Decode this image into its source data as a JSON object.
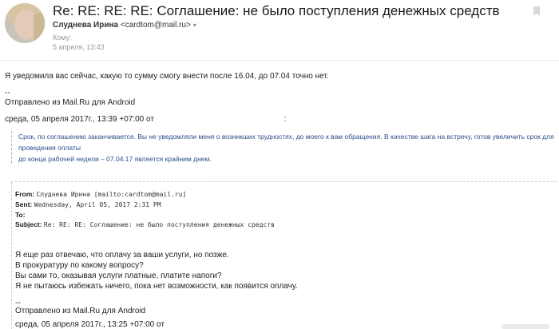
{
  "header": {
    "subject": "Re: RE: RE: RE: Соглашение: не было поступления денежных средств",
    "from_name": "Слуднева Ирина",
    "from_email": "<cardtom@mail.ru>",
    "to_label": "Кому:",
    "date": "5 апреля, 13:43"
  },
  "body": {
    "line1": "Я уведомила вас сейчас, какую то сумму смогу внести после 16.04, до 07.04 точно нет.",
    "dash1": "--",
    "sent_from1": "Отправлено из Mail.Ru для Android",
    "quote_header1": "среда, 05 апреля 2017г., 13:39 +07:00 от",
    "quote_header1_tail": ":",
    "quote_line1": "Срок, по соглашению заканчивается. Вы не уведомляли меня о возникших трудностях, до моего к вам обращения. В качестве шага на встречу, готов увеличить срок для проведения оплаты",
    "quote_line2": "до конца рабочей недели – 07.04.17 является крайним днем."
  },
  "inner": {
    "from_label": "From:",
    "from_value": "Слуднева Ирина [mailto:cardtom@mail.ru]",
    "sent_label": "Sent:",
    "sent_value": "Wednesday, April 05, 2017 2:31 PM",
    "to_label": "To:",
    "subject_label": "Subject:",
    "subject_value": "Re: RE: RE: Соглашение: не было поступления денежных средств",
    "lines": [
      "Я еще раз отвечаю, что оплачу за ваши услуги, но позже.",
      "В прокуратуру по какому вопросу?",
      "Вы сами то, оказывая услуги платные, платите напоги?",
      "Я не пытаюсь избежать ничего, пока нет возможности, как появится оплачу."
    ],
    "dash": "--",
    "sent_from": "Отправлено из Mail.Ru для Android",
    "quote_header": "среда, 05 апреля 2017г., 13:25 +07:00 от"
  },
  "icons": {
    "flag": "bookmark-flag-icon",
    "dropdown": "chevron-down-icon",
    "avatar": "user-avatar"
  },
  "colors": {
    "quote_text": "#2b4f8a",
    "meta_gray": "#9a9a9a"
  }
}
